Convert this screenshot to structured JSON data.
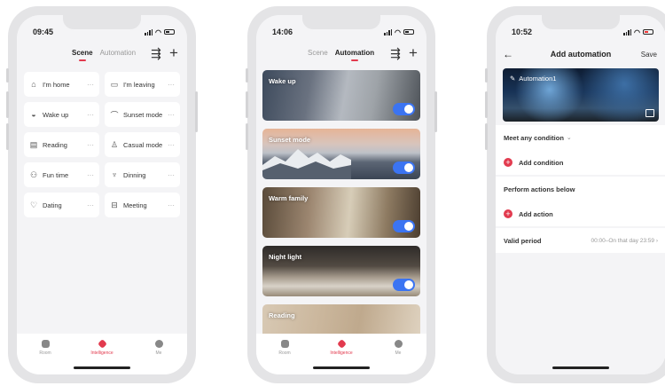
{
  "screen1": {
    "time": "09:45",
    "tabs": [
      "Scene",
      "Automation"
    ],
    "scenes": [
      {
        "label": "I'm home",
        "icon": "home-icon",
        "glyph": "⌂"
      },
      {
        "label": "I'm leaving",
        "icon": "briefcase-icon",
        "glyph": "▭"
      },
      {
        "label": "Wake up",
        "icon": "sunrise-icon",
        "glyph": "◒"
      },
      {
        "label": "Sunset mode",
        "icon": "sunset-icon",
        "glyph": "⌒"
      },
      {
        "label": "Reading",
        "icon": "book-icon",
        "glyph": "▤"
      },
      {
        "label": "Casual mode",
        "icon": "person-icon",
        "glyph": "♙"
      },
      {
        "label": "Fun time",
        "icon": "bike-icon",
        "glyph": "⚇"
      },
      {
        "label": "Dinning",
        "icon": "cup-icon",
        "glyph": "♆"
      },
      {
        "label": "Dating",
        "icon": "heart-icon",
        "glyph": "♡"
      },
      {
        "label": "Meeting",
        "icon": "car-icon",
        "glyph": "⊟"
      }
    ],
    "more_label": "···",
    "nav": [
      "Room",
      "Intelligence",
      "Me"
    ]
  },
  "screen2": {
    "time": "14:06",
    "tabs": [
      "Scene",
      "Automation"
    ],
    "automations": [
      {
        "label": "Wake up",
        "enabled": true
      },
      {
        "label": "Sunset mode",
        "enabled": true
      },
      {
        "label": "Warm family",
        "enabled": true
      },
      {
        "label": "Night light",
        "enabled": true
      },
      {
        "label": "Reading",
        "enabled": true
      }
    ],
    "nav": [
      "Room",
      "Intelligence",
      "Me"
    ]
  },
  "screen3": {
    "time": "10:52",
    "title": "Add automation",
    "save_label": "Save",
    "automation_name": "Automation1",
    "condition_title": "Meet any condition",
    "add_condition_label": "Add condition",
    "actions_title": "Perform actions below",
    "add_action_label": "Add action",
    "valid_period_label": "Valid period",
    "valid_period_value": "00:00–On that day 23:59"
  },
  "colors": {
    "accent": "#e23a4e",
    "toggle": "#3b74f2"
  }
}
